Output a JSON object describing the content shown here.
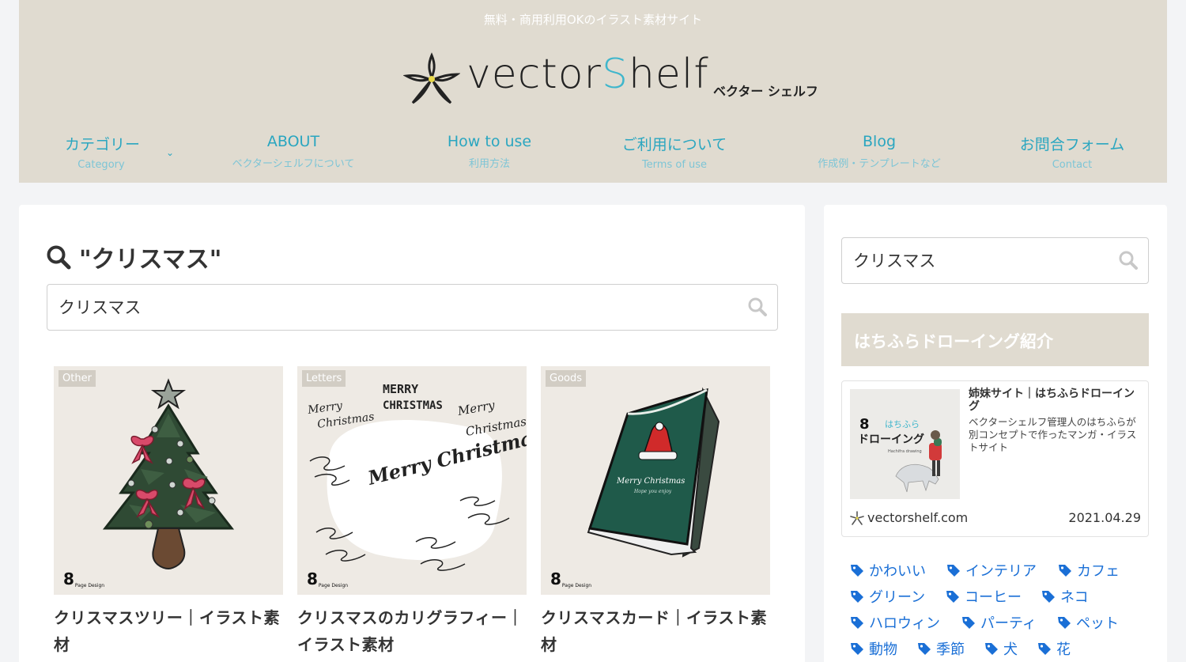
{
  "header": {
    "tagline": "無料・商用利用OKのイラスト素材サイト",
    "logo_main": "vector",
    "logo_accent": "S",
    "logo_end": "helf",
    "logo_sub": "ベクター シェルフ",
    "nav": [
      {
        "label": "カテゴリー",
        "sub": "Category"
      },
      {
        "label": "ABOUT",
        "sub": "ベクターシェルフについて"
      },
      {
        "label": "How to use",
        "sub": "利用方法"
      },
      {
        "label": "ご利用について",
        "sub": "Terms of use"
      },
      {
        "label": "Blog",
        "sub": "作成例・テンプレートなど"
      },
      {
        "label": "お問合フォーム",
        "sub": "Contact"
      }
    ]
  },
  "main": {
    "search_heading": "\"クリスマス\"",
    "search_value": "クリスマス",
    "cards": [
      {
        "category": "Other",
        "title": "クリスマスツリー｜イラスト素材"
      },
      {
        "category": "Letters",
        "title": "クリスマスのカリグラフィー｜イラスト素材"
      },
      {
        "category": "Goods",
        "title": "クリスマスカード｜イラスト素材"
      }
    ],
    "brand": "8",
    "brand_small": "Page Design",
    "calligraphy": [
      "MERRY",
      "CHRISTMAS",
      "Merry",
      "Christmas",
      "Merry Christmas",
      "Merry",
      "Christmas"
    ],
    "card_text": "Merry Christmas",
    "card_subtext": "Hope you enjoy"
  },
  "sidebar": {
    "search_value": "クリスマス",
    "widget_title": "はちふらドローイング紹介",
    "blogcard": {
      "title": "姉妹サイト｜はちふらドローイング",
      "desc": "ベクターシェルフ管理人のはちふらが別コンセプトで作ったマンガ・イラストサイト",
      "site": "vectorshelf.com",
      "date": "2021.04.29",
      "thumb_title": "ドローイング",
      "thumb_kana": "はちふら",
      "thumb_sub": "Hachifra drawing"
    },
    "tags": [
      "かわいい",
      "インテリア",
      "カフェ",
      "グリーン",
      "コーヒー",
      "ネコ",
      "ハロウィン",
      "パーティ",
      "ペット",
      "動物",
      "季節",
      "犬",
      "花"
    ]
  },
  "colors": {
    "header_bg": "#e0dbd0",
    "accent": "#2aa6c0",
    "tag": "#1a6fd6"
  }
}
